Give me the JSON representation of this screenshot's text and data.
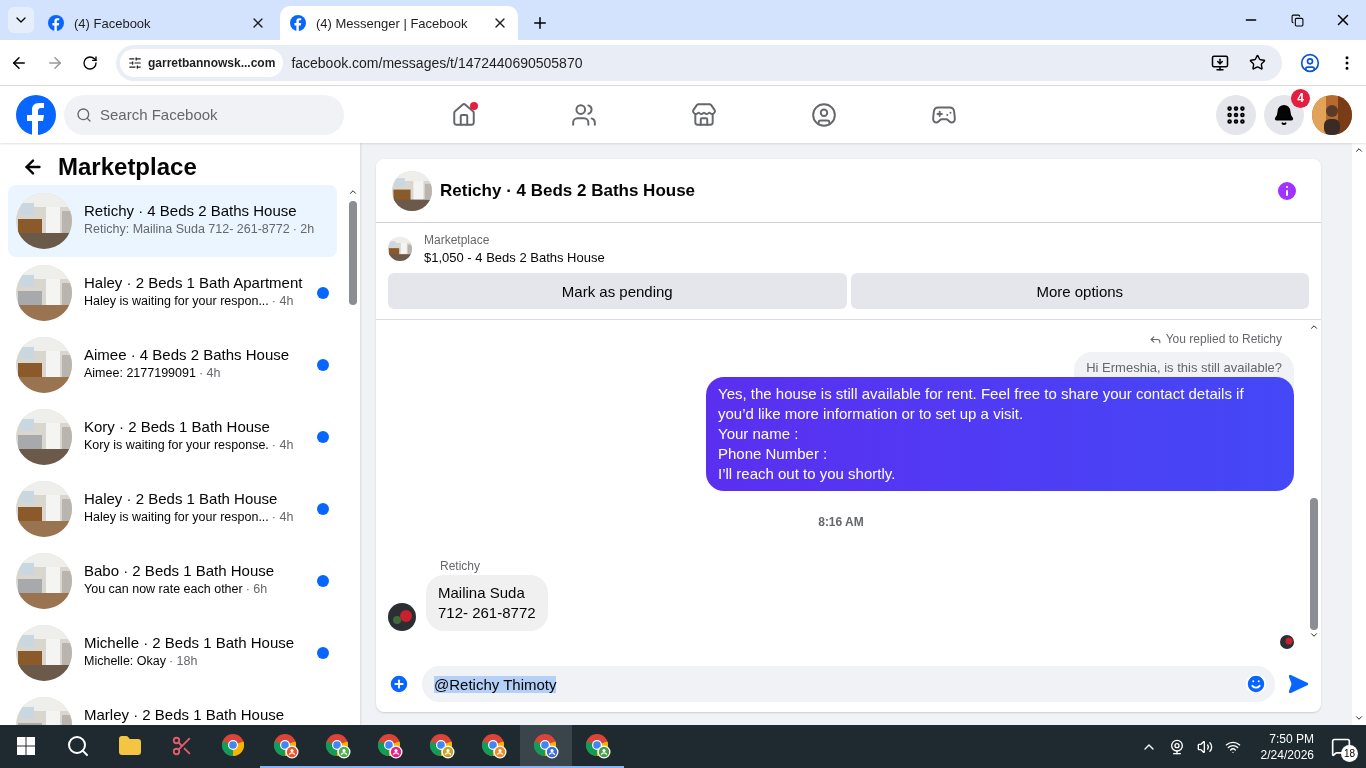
{
  "browser": {
    "tabs": [
      {
        "title": "(4) Facebook",
        "selected": false
      },
      {
        "title": "(4) Messenger | Facebook",
        "selected": true
      }
    ],
    "site_chip": "garretbannowsk...com",
    "url": "facebook.com/messages/t/1472440690505870"
  },
  "header": {
    "search": {
      "placeholder": "Search Facebook"
    },
    "nav": [
      {
        "kind": "home",
        "dot": true
      },
      {
        "kind": "friends",
        "dot": false
      },
      {
        "kind": "marketplace",
        "dot": false
      },
      {
        "kind": "groups",
        "dot": false
      },
      {
        "kind": "gaming",
        "dot": false
      }
    ],
    "notifications_badge": "4"
  },
  "sidebar": {
    "title": "Marketplace",
    "conversations": [
      {
        "name": "Retichy · 4 Beds 2 Baths House",
        "preview": "Retichy: Mailina Suda 712- 261-8772",
        "time": "· 2h",
        "selected": true,
        "unread": false
      },
      {
        "name": "Haley · 2 Beds 1 Bath Apartment",
        "preview": "Haley is waiting for your respon...",
        "time": "· 4h",
        "selected": false,
        "unread": true
      },
      {
        "name": "Aimee · 4 Beds 2 Baths House",
        "preview": "Aimee: 2177199091",
        "time": "· 4h",
        "selected": false,
        "unread": true
      },
      {
        "name": "Kory · 2 Beds 1 Bath House",
        "preview": "Kory is waiting for your response.",
        "time": "· 4h",
        "selected": false,
        "unread": true
      },
      {
        "name": "Haley · 2 Beds 1 Bath House",
        "preview": "Haley is waiting for your respon...",
        "time": "· 4h",
        "selected": false,
        "unread": true
      },
      {
        "name": "Babo · 2 Beds 1 Bath House",
        "preview": "You can now rate each other",
        "time": "· 6h",
        "selected": false,
        "unread": true
      },
      {
        "name": "Michelle · 2 Beds 1 Bath House",
        "preview": "Michelle: Okay",
        "time": "· 18h",
        "selected": false,
        "unread": true
      },
      {
        "name": "Marley · 2 Beds 1 Bath House",
        "selected": false
      }
    ]
  },
  "chat": {
    "title": "Retichy · 4 Beds 2 Baths House",
    "listing": {
      "label": "Marketplace",
      "title": "$1,050 - 4 Beds 2 Baths House"
    },
    "actions": [
      "Mark as pending",
      "More options"
    ],
    "reply_note": "You replied to Retichy",
    "quoted": "Hi Ermeshia, is this still available?",
    "outgoing": [
      "Yes, the house is still available for rent. Feel free to share your contact details if you’d like more information or to set up a visit.",
      "Your name :",
      "Phone Number :",
      "I’ll reach out to you shortly."
    ],
    "timestamp": "8:16 AM",
    "sender": "Retichy",
    "incoming": [
      "Mailina Suda",
      "712- 261-8772"
    ],
    "composer": {
      "value": "@Retichy Thimoty",
      "value_selected": true
    }
  },
  "taskbar": {
    "apps": [
      {
        "kind": "search",
        "open": false,
        "selected": false
      },
      {
        "kind": "folder",
        "open": false,
        "selected": false
      },
      {
        "kind": "snip",
        "open": false,
        "selected": false
      },
      {
        "kind": "chrome",
        "open": false,
        "selected": false
      },
      {
        "kind": "profile",
        "color": "#e8552a",
        "open": true,
        "selected": false
      },
      {
        "kind": "profile",
        "color": "#4caf50",
        "open": true,
        "selected": false
      },
      {
        "kind": "profile",
        "color": "#e91e8c",
        "open": true,
        "selected": false
      },
      {
        "kind": "profile",
        "color": "#c9a227",
        "open": true,
        "selected": false
      },
      {
        "kind": "profile",
        "color": "#f08a24",
        "open": true,
        "selected": false
      },
      {
        "kind": "profile",
        "color": "#3b6fd8",
        "open": true,
        "selected": true
      },
      {
        "kind": "profile",
        "color": "#43a047",
        "open": true,
        "selected": false
      }
    ],
    "time": "7:50 PM",
    "date": "2/24/2026",
    "notification_count": "18"
  }
}
